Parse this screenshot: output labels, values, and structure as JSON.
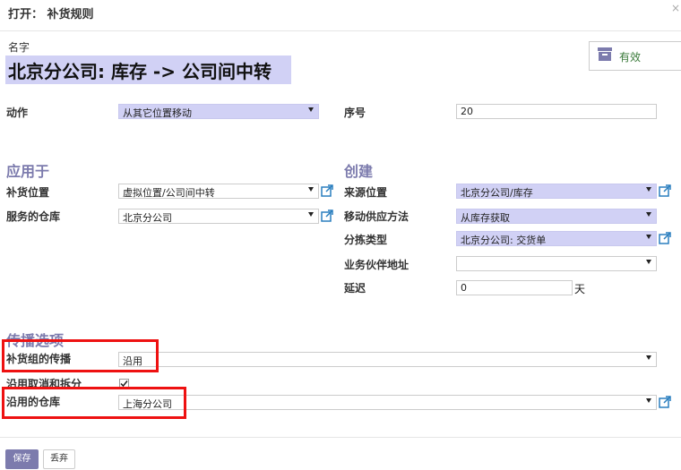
{
  "dialog": {
    "title": "打开： 补货规则",
    "close": "×"
  },
  "name": {
    "label": "名字",
    "value": "北京分公司: 库存 -> 公司间中转"
  },
  "status": {
    "label": "有效",
    "icon": "archive-icon"
  },
  "fields": {
    "action": {
      "label": "动作",
      "value": "从其它位置移动"
    },
    "sequence": {
      "label": "序号",
      "value": "20"
    },
    "replenish_location": {
      "label": "补货位置",
      "value": "虚拟位置/公司间中转"
    },
    "served_warehouse": {
      "label": "服务的仓库",
      "value": "北京分公司"
    },
    "source_location": {
      "label": "来源位置",
      "value": "北京分公司/库存"
    },
    "supply_method": {
      "label": "移动供应方法",
      "value": "从库存获取"
    },
    "picking_type": {
      "label": "分拣类型",
      "value": "北京分公司: 交货单"
    },
    "partner_address": {
      "label": "业务伙伴地址",
      "value": ""
    },
    "delay": {
      "label": "延迟",
      "value": "0",
      "unit": "天"
    },
    "group_propagation": {
      "label": "补货组的传播",
      "value": "沿用"
    },
    "propagate_cancel": {
      "label": "沿用取消和拆分",
      "checked": true
    },
    "propagate_warehouse": {
      "label": "沿用的仓库",
      "value": "上海分公司"
    }
  },
  "sections": {
    "applies_to": "应用于",
    "create": "创建",
    "propagation": "传播选项"
  },
  "buttons": {
    "save": "保存",
    "discard": "丢弃"
  },
  "colors": {
    "accent": "#7c7bad",
    "required_bg": "#d1d1f5",
    "highlight": "#e11111",
    "active_green": "#3a7a3a"
  }
}
